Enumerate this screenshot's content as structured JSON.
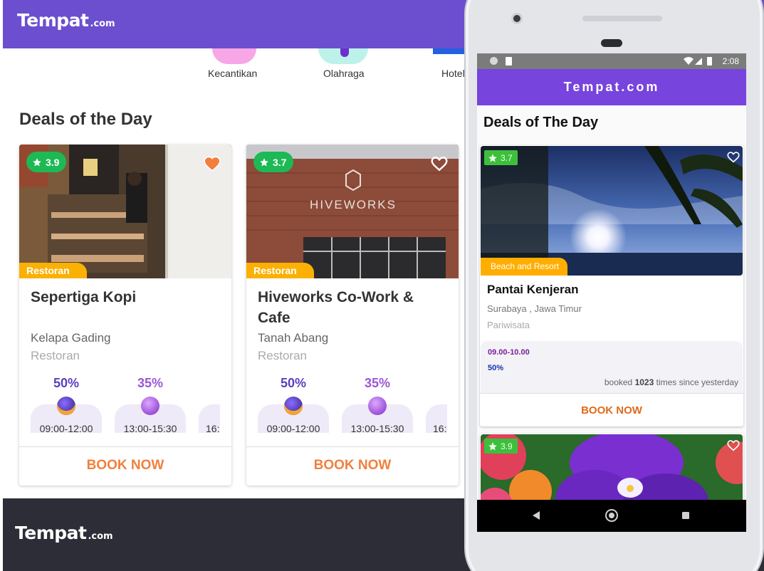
{
  "web": {
    "logo_main": "Tempat",
    "logo_domain": ".com",
    "categories": [
      "Kecantikan",
      "Olahraga",
      "Hotel"
    ],
    "deals_title": "Deals of the Day",
    "cards": [
      {
        "rating": "3.9",
        "favorited": true,
        "tag": "Restoran",
        "title": "Sepertiga Kopi",
        "location": "Kelapa Gading",
        "type": "Restoran",
        "slots": [
          {
            "percent": "50%",
            "time": "09:00-12:00"
          },
          {
            "percent": "35%",
            "time": "13:00-15:30"
          },
          {
            "percent": "",
            "time": "16:"
          }
        ],
        "book_label": "BOOK NOW"
      },
      {
        "rating": "3.7",
        "favorited": false,
        "tag": "Restoran",
        "title": "Hiveworks Co-Work & Cafe",
        "location": "Tanah Abang",
        "type": "Restoran",
        "slots": [
          {
            "percent": "50%",
            "time": "09:00-12:00"
          },
          {
            "percent": "35%",
            "time": "13:00-15:30"
          },
          {
            "percent": "",
            "time": "16:"
          }
        ],
        "book_label": "BOOK NOW"
      }
    ],
    "footer": {
      "logo_main": "Tempat",
      "logo_domain": ".com"
    }
  },
  "mobile": {
    "status": {
      "time": "2:08"
    },
    "app_title": "Tempat.com",
    "deals_title": "Deals of The Day",
    "cards": [
      {
        "rating": "3.7",
        "tag": "Beach and Resort",
        "title": "Pantai Kenjeran",
        "location": "Surabaya , Jawa Timur",
        "type": "Pariwisata",
        "offer_time": "09.00-10.00",
        "offer_percent": "50%",
        "booked_prefix": "booked",
        "booked_count": "1023",
        "booked_suffix": "times since yesterday",
        "book_label": "BOOK NOW"
      },
      {
        "rating": "3.9"
      }
    ]
  },
  "colors": {
    "brand_purple": "#6b4fcf",
    "app_bar": "#7744dd",
    "rating_green": "#1db954",
    "tag_orange": "#fbb004",
    "book_orange": "#f27f3d",
    "footer_dark": "#2d2d37"
  },
  "icons": [
    "star-icon",
    "heart-icon",
    "wifi-icon",
    "signal-icon",
    "battery-icon",
    "back-icon",
    "home-icon",
    "recents-icon"
  ]
}
